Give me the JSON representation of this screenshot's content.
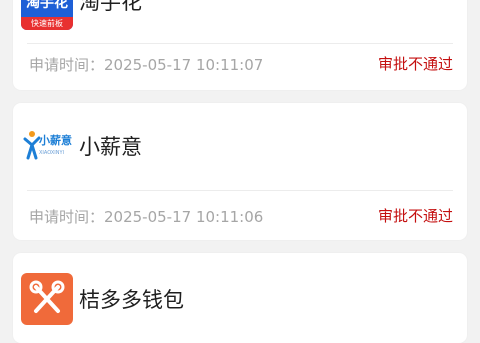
{
  "colors": {
    "background": "#f2f2f2",
    "card": "#ffffff",
    "time_text": "#a6a6a6",
    "status_rejected": "#c40f0f"
  },
  "apps": [
    {
      "name": "淘手花",
      "logo_text": "淘手花",
      "logo_badge": "快速前板",
      "apply_time_label": "申请时间：2025-05-17 10:11:07",
      "status": "审批不通过"
    },
    {
      "name": "小薪意",
      "logo_text": "小薪意",
      "logo_subtext": "XIAOXINYI",
      "apply_time_label": "申请时间：2025-05-17 10:11:06",
      "status": "审批不通过"
    },
    {
      "name": "桔多多钱包",
      "logo_icon": "crossed-tools-icon"
    }
  ]
}
